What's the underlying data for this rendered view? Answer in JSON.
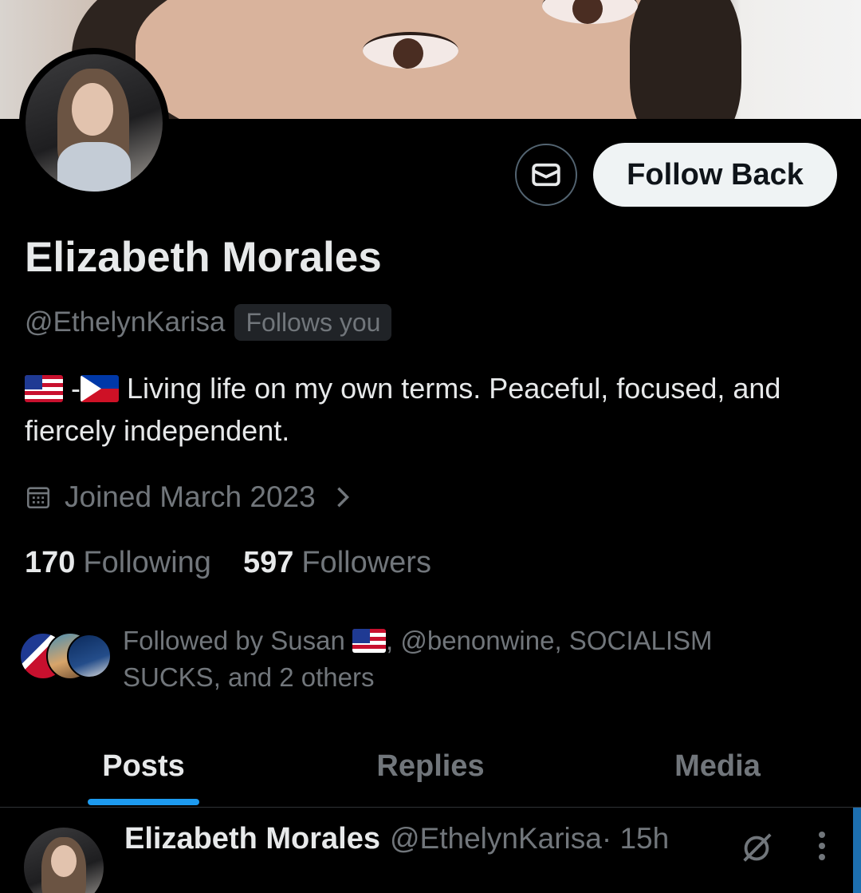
{
  "profile": {
    "name": "Elizabeth Morales",
    "handle": "@EthelynKarisa",
    "follows_you_badge": "Follows you",
    "bio": "Living life on my own terms. Peaceful, focused, and fiercely independent.",
    "bio_flag_separator": "-",
    "joined": "Joined March 2023",
    "following_count": "170",
    "following_label": "Following",
    "followers_count": "597",
    "followers_label": "Followers",
    "followed_by_prefix": "Followed by Susan",
    "followed_by_rest": ", @benonwine, SOCIALISM SUCKS, and 2 others"
  },
  "actions": {
    "message_icon": "envelope-icon",
    "follow_back_label": "Follow Back"
  },
  "tabs": [
    {
      "label": "Posts",
      "active": true
    },
    {
      "label": "Replies",
      "active": false
    },
    {
      "label": "Media",
      "active": false
    }
  ],
  "post": {
    "author_name": "Elizabeth Morales",
    "author_handle": "@EthelynKarisa",
    "time": " · 15h"
  },
  "colors": {
    "background": "#000000",
    "accent": "#1d9bf0",
    "text_primary": "#e7e9ea",
    "text_secondary": "#71767b"
  }
}
